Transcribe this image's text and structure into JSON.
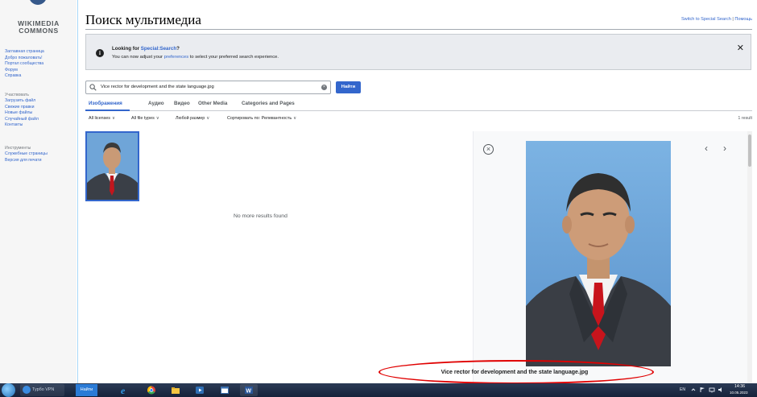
{
  "sidebar": {
    "logo_line1": "WIKIMEDIA",
    "logo_line2": "COMMONS",
    "nav": [
      "Заглавная страница",
      "Добро пожаловать!",
      "Портал сообщества",
      "Форум",
      "Справка"
    ],
    "participate_heading": "Участвовать",
    "participate": [
      "Загрузить файл",
      "Свежие правки",
      "Новые файлы",
      "Случайный файл",
      "Контакты"
    ],
    "tools_heading": "Инструменты",
    "tools": [
      "Служебные страницы",
      "Версия для печати"
    ]
  },
  "header": {
    "title": "Поиск мультимедиа",
    "link_special": "Switch to Special Search",
    "link_separator": "|",
    "link_help": "Помощь"
  },
  "notice": {
    "icon": "info-icon",
    "title_prefix": "Looking for ",
    "title_link": "Special:Search",
    "title_suffix": "?",
    "body_prefix": "You can now adjust your ",
    "body_link": "preferences",
    "body_suffix": " to select your preferred search experience.",
    "close": "✕"
  },
  "search": {
    "value": "Vice rector for development and the state language.jpg",
    "button_label": "Найти"
  },
  "tabs": [
    "Изображения",
    "Аудио",
    "Видео",
    "Other Media",
    "Categories and Pages"
  ],
  "filters": {
    "licenses": "All licenses",
    "file_types": "All file types",
    "size": "Любой размер",
    "sort": "Сортировать по: Релевантность",
    "chevron": "∨",
    "result_count": "1 result"
  },
  "results": {
    "no_more": "No more results found"
  },
  "detail": {
    "close": "×",
    "prev": "‹",
    "next": "›",
    "file_title": "Vice rector for development and the state language.jpg"
  },
  "taskbar": {
    "vpn_label": "Турбо VPN",
    "search_label": "Найти",
    "lang": "EN",
    "time": "14:36",
    "date": "10.05.2023"
  },
  "colors": {
    "link": "#3366cc",
    "highlight_oval": "#e00000",
    "photo_background": "#6fa5d8"
  }
}
